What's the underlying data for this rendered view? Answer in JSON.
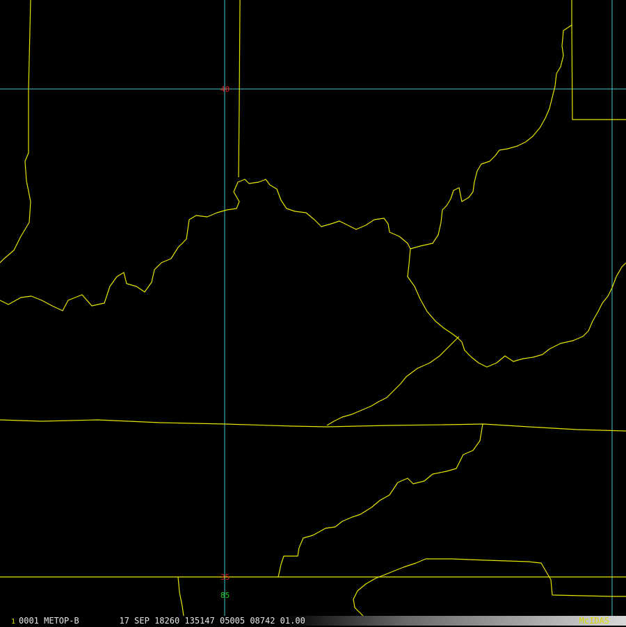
{
  "map": {
    "latitude_labels": [
      "40",
      "35"
    ],
    "longitude_labels": [
      "85"
    ],
    "label_colors": {
      "latitude": "#dd2222",
      "longitude": "#22cc22"
    },
    "gridline_color": "#40c8c8",
    "border_color": "#e6e600",
    "background": "#000000"
  },
  "status_bar": {
    "frame_number": "1",
    "text": "0001 METOP-B        17 SEP 18260 135147 05005 08742 01.00",
    "brand": "McIDAS"
  }
}
